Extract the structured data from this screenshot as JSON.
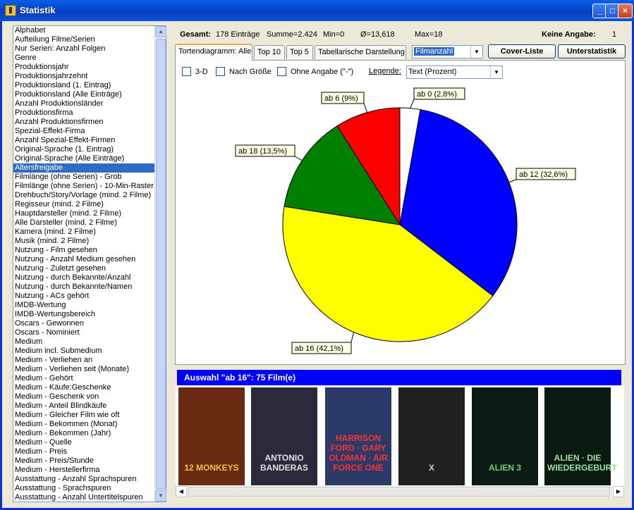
{
  "window": {
    "title": "Statistik",
    "buttons": [
      "_",
      "□",
      "×"
    ]
  },
  "list": {
    "selected_index": 15,
    "items": [
      "Alphabet",
      "Aufteilung Filme/Serien",
      "Nur Serien: Anzahl Folgen",
      "Genre",
      "Produktionsjahr",
      "Produktionsjahrzehnt",
      "Produktionsland (1. Eintrag)",
      "Produktionsland (Alle Einträge)",
      "Anzahl Produktionsländer",
      "Produktionsfirma",
      "Anzahl Produktionsfirmen",
      "Spezial-Effekt-Firma",
      "Anzahl Spezial-Effekt-Firmen",
      "Original-Sprache (1. Eintrag)",
      "Original-Sprache (Alle Einträge)",
      "Altersfreigabe",
      "Filmlänge (ohne Serien) - Grob",
      "Filmlänge (ohne Serien) - 10-Min-Raster",
      "Drehbuch/Story/Vorlage (mind. 2 Filme)",
      "Regisseur (mind. 2 Filme)",
      "Hauptdarsteller (mind. 2 Filme)",
      "Alle Darsteller (mind. 2 Filme)",
      "Kamera (mind. 2 Filme)",
      "Musik (mind. 2 Filme)",
      "Nutzung - Film gesehen",
      "Nutzung - Anzahl Medium gesehen",
      "Nutzung - Zuletzt gesehen",
      "Nutzung - durch Bekannte/Anzahl",
      "Nutzung - durch Bekannte/Namen",
      "Nutzung - ACs gehört",
      "IMDB-Wertung",
      "IMDB-Wertungsbereich",
      "Oscars - Gewonnen",
      "Oscars - Nominiert",
      "Medium",
      "Medium incl. Submedium",
      "Medium - Verliehen an",
      "Medium - Verliehen seit (Monate)",
      "Medium - Gehört",
      "Medium - Käufe:Geschenke",
      "Medium - Geschenk von",
      "Medium - Anteil Blindkäufe",
      "Medium - Gleicher Film wie oft",
      "Medium - Bekommen (Monat)",
      "Medium - Bekommen (Jahr)",
      "Medium - Quelle",
      "Medium - Preis",
      "Medium - Preis/Stunde",
      "Medium - Herstellerfirma",
      "Ausstattung - Anzahl Sprachspuren",
      "Ausstattung - Sprachspuren",
      "Ausstattung - Anzahl Untertitelspuren"
    ]
  },
  "summary": {
    "gesamt_label": "Gesamt:",
    "gesamt_value": "178 Einträge",
    "summe": "Summe=2.424",
    "min": "Min=0",
    "avg": "Ø=13,618",
    "max": "Max=18",
    "keine_label": "Keine Angabe:",
    "keine_value": "1"
  },
  "tabs": [
    "Tortendiagramm: Alle",
    "Top 10",
    "Top 5",
    "Tabellarische Darstellung"
  ],
  "filter_combo": "Filmanzahl",
  "buttons": {
    "cover": "Cover-Liste",
    "unter": "Unterstatistik"
  },
  "options": {
    "d3": "3-D",
    "size": "Nach Größe",
    "ohne": "Ohne Angabe (\"-\")",
    "legend_label": "Legende:",
    "legend_value": "Text (Prozent)"
  },
  "chart_data": {
    "type": "pie",
    "series": [
      {
        "label": "ab 0 (2,8%)",
        "value": 2.8,
        "color": "#ffffff"
      },
      {
        "label": "ab 12 (32,6%)",
        "value": 32.6,
        "color": "#0000ff"
      },
      {
        "label": "ab 16 (42,1%)",
        "value": 42.1,
        "color": "#ffff00"
      },
      {
        "label": "ab 18 (13,5%)",
        "value": 13.5,
        "color": "#008000"
      },
      {
        "label": "ab 6 (9%)",
        "value": 9.0,
        "color": "#ff0000"
      }
    ]
  },
  "selection": {
    "title": "Auswahl \"ab 16\": 75 Film(e)"
  },
  "covers": [
    {
      "text": "12 MONKEYS",
      "bg": "#6b2a12",
      "fg": "#f0c040"
    },
    {
      "text": "ANTONIO BANDERAS",
      "bg": "#2a2a3a",
      "fg": "#e0e0e0"
    },
    {
      "text": "HARRISON FORD · GARY OLDMAN · AIR FORCE ONE",
      "bg": "#2b3a66",
      "fg": "#ff3030"
    },
    {
      "text": "X",
      "bg": "#202020",
      "fg": "#d0d0d0"
    },
    {
      "text": "ALIEN 3",
      "bg": "#0c1c14",
      "fg": "#6ad07a"
    },
    {
      "text": "ALIEN · DIE WIEDERGEBURT",
      "bg": "#0a1a10",
      "fg": "#9ae0a0"
    }
  ]
}
